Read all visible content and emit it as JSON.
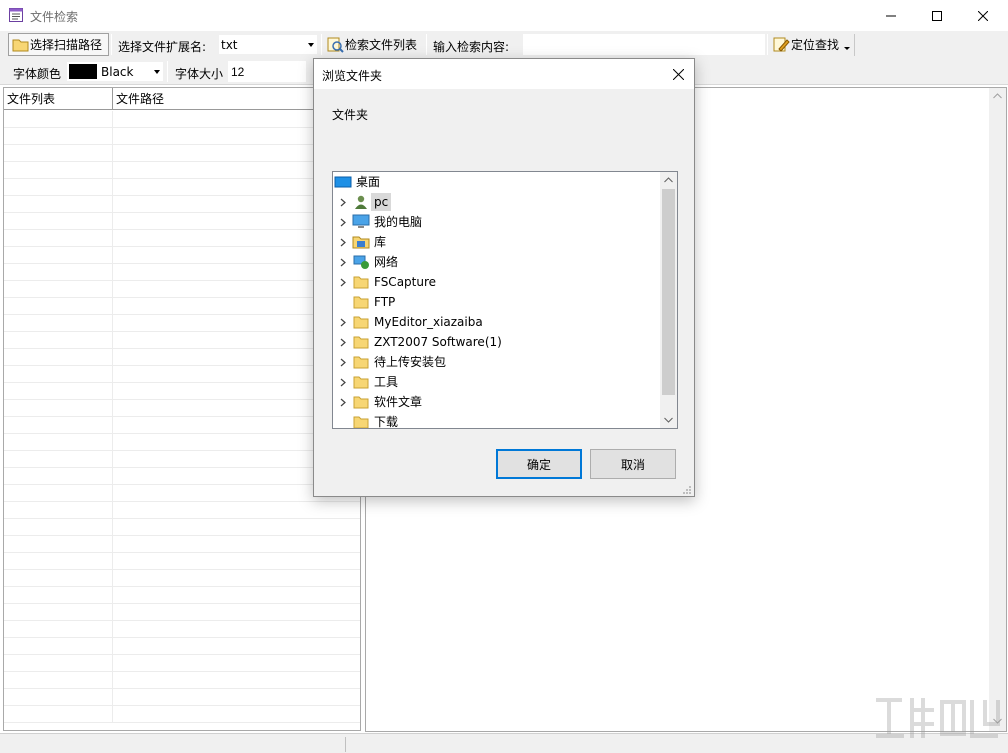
{
  "window": {
    "title": "文件检索"
  },
  "toolbar": {
    "select_path_label": "选择扫描路径",
    "ext_label": "选择文件扩展名:",
    "ext_value": "txt",
    "search_list_label": "检索文件列表",
    "content_label": "输入检索内容:",
    "content_value": "",
    "locate_label": "定位查找",
    "font_color_label": "字体颜色",
    "font_color_value": "Black",
    "font_color_swatch": "#000000",
    "font_size_label": "字体大小",
    "font_size_value": "12"
  },
  "list": {
    "columns": [
      "文件列表",
      "文件路径"
    ]
  },
  "dialog": {
    "title": "浏览文件夹",
    "description": "文件夹",
    "tree": [
      {
        "label": "桌面",
        "icon": "desktop-icon",
        "expandable": false,
        "selected": false,
        "root": true
      },
      {
        "label": "pc",
        "icon": "user-icon",
        "expandable": true,
        "selected": true
      },
      {
        "label": "我的电脑",
        "icon": "computer-icon",
        "expandable": true,
        "selected": false
      },
      {
        "label": "库",
        "icon": "library-icon",
        "expandable": true,
        "selected": false
      },
      {
        "label": "网络",
        "icon": "network-icon",
        "expandable": true,
        "selected": false
      },
      {
        "label": "FSCapture",
        "icon": "folder-icon",
        "expandable": true,
        "selected": false
      },
      {
        "label": "FTP",
        "icon": "folder-icon",
        "expandable": false,
        "selected": false
      },
      {
        "label": "MyEditor_xiazaiba",
        "icon": "folder-icon",
        "expandable": true,
        "selected": false
      },
      {
        "label": "ZXT2007 Software(1)",
        "icon": "folder-icon",
        "expandable": true,
        "selected": false
      },
      {
        "label": "待上传安装包",
        "icon": "folder-icon",
        "expandable": true,
        "selected": false
      },
      {
        "label": "工具",
        "icon": "folder-icon",
        "expandable": true,
        "selected": false
      },
      {
        "label": "软件文章",
        "icon": "folder-icon",
        "expandable": true,
        "selected": false
      },
      {
        "label": "下载",
        "icon": "folder-icon",
        "expandable": false,
        "selected": false
      }
    ],
    "ok_label": "确定",
    "cancel_label": "取消"
  },
  "colors": {
    "accent": "#0078d7",
    "folder": "#f7d674"
  }
}
